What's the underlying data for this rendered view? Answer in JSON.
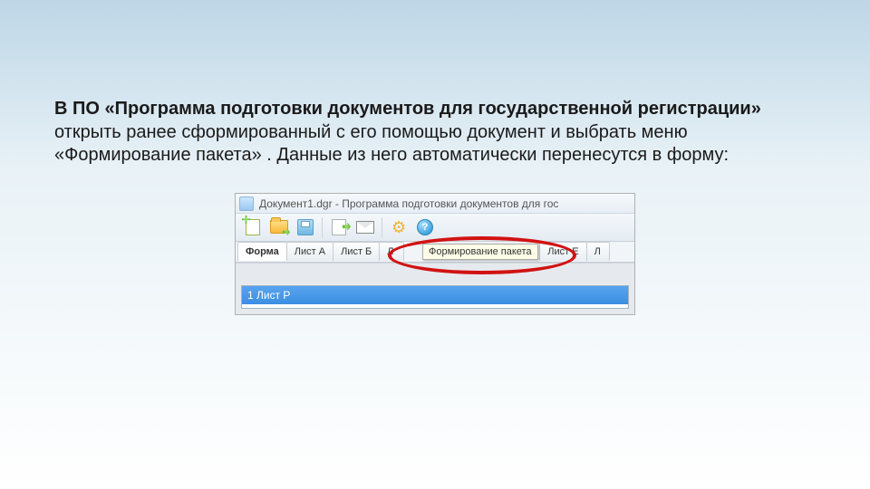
{
  "description": {
    "part1": "В ПО «Программа подготовки документов для государственной регистрации»",
    "part2": " открыть ранее сформированный с его помощью документ и выбрать меню «Формирование пакета» . Данные из него автоматически перенесутся в форму:"
  },
  "window_title": "Документ1.dgr - Программа подготовки документов для гос",
  "help_glyph": "?",
  "tabs": {
    "t0": "Форма",
    "t1": "Лист А",
    "t2": "Лист Б",
    "t3": "Л",
    "t4": "Лист Е",
    "t5": "Л"
  },
  "tooltip": "Формирование пакета",
  "list_item": "1 Лист Р"
}
